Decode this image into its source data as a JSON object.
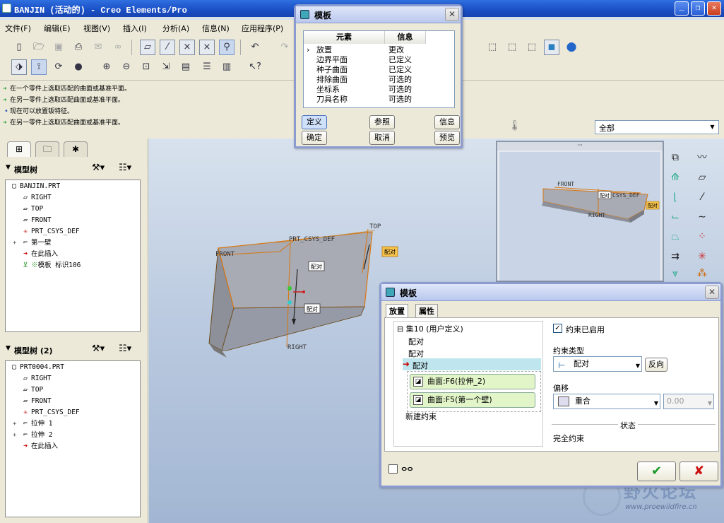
{
  "window": {
    "title": "BANJIN (活动的) - Creo Elements/Pro"
  },
  "menu": [
    "文件(F)",
    "编辑(E)",
    "视图(V)",
    "插入(I)",
    "分析(A)",
    "信息(N)",
    "应用程序(P)"
  ],
  "messages": [
    {
      "icon": "arrow",
      "text": "在一个零件上选取匹配的曲面或基准平面。"
    },
    {
      "icon": "arrow",
      "text": "在另一零件上选取匹配曲面或基准平面。"
    },
    {
      "icon": "dot",
      "text": "现在可以放置钣特征。"
    },
    {
      "icon": "arrow",
      "text": "在另一零件上选取匹配曲面或基准平面。"
    }
  ],
  "filter": {
    "value": "全部"
  },
  "model_tree_1": {
    "heading": "模型树",
    "items": [
      "BANJIN.PRT",
      "RIGHT",
      "TOP",
      "FRONT",
      "PRT_CSYS_DEF",
      "第一壁",
      "在此插入",
      "模板  标识106"
    ]
  },
  "model_tree_2": {
    "heading": "模型树 (2)",
    "items": [
      "PRT0004.PRT",
      "RIGHT",
      "TOP",
      "FRONT",
      "PRT_CSYS_DEF",
      "拉伸 1",
      "拉伸 2",
      "在此插入"
    ]
  },
  "viewport": {
    "labels": {
      "front": "FRONT",
      "csys": "PRT_CSYS_DEF",
      "top": "TOP",
      "right": "RIGHT",
      "mate1": "配对",
      "mate2": "配对",
      "mate3": "配对"
    }
  },
  "preview": {
    "labels": {
      "front": "FRONT",
      "csys": "CSYS_DEF",
      "right": "RIGHT",
      "mate1": "配对",
      "mate2": "配对"
    }
  },
  "template_dialog": {
    "title": "模板",
    "col_element": "元素",
    "col_info": "信息",
    "rows": [
      {
        "element": "放置",
        "info": "更改"
      },
      {
        "element": "边界平面",
        "info": "已定义"
      },
      {
        "element": "种子曲面",
        "info": "已定义"
      },
      {
        "element": "排除曲面",
        "info": "可选的"
      },
      {
        "element": "坐标系",
        "info": "可选的"
      },
      {
        "element": "刀具名称",
        "info": "可选的"
      }
    ],
    "buttons": {
      "define": "定义",
      "refs": "参照",
      "info": "信息",
      "ok": "确定",
      "cancel": "取消",
      "preview": "预览"
    }
  },
  "placement_dialog": {
    "title": "模板",
    "tabs": [
      "放置",
      "属性"
    ],
    "set_label": "集10 (用户定义)",
    "constraints": [
      "配对",
      "配对",
      "配对"
    ],
    "refs": [
      "曲面:F6(拉伸_2)",
      "曲面:F5(第一个壁)"
    ],
    "new_constraint": "新建约束",
    "enabled_label": "约束已启用",
    "type_label": "约束类型",
    "type_value": "配对",
    "flip_label": "反向",
    "offset_label": "偏移",
    "offset_value": "重合",
    "offset_number": "0.00",
    "status_label": "状态",
    "status_value": "完全约束"
  },
  "watermark": {
    "name": "野火论坛",
    "url": "www.proewildfire.cn"
  },
  "colors": {
    "title_bar": "#1a4fc4",
    "part_fill": "#a8aab4",
    "accent_orange": "#d9770f",
    "tag_yellow": "#f6c24a",
    "confirm_green": "#1a9a2a",
    "cancel_red": "#cc1111"
  }
}
